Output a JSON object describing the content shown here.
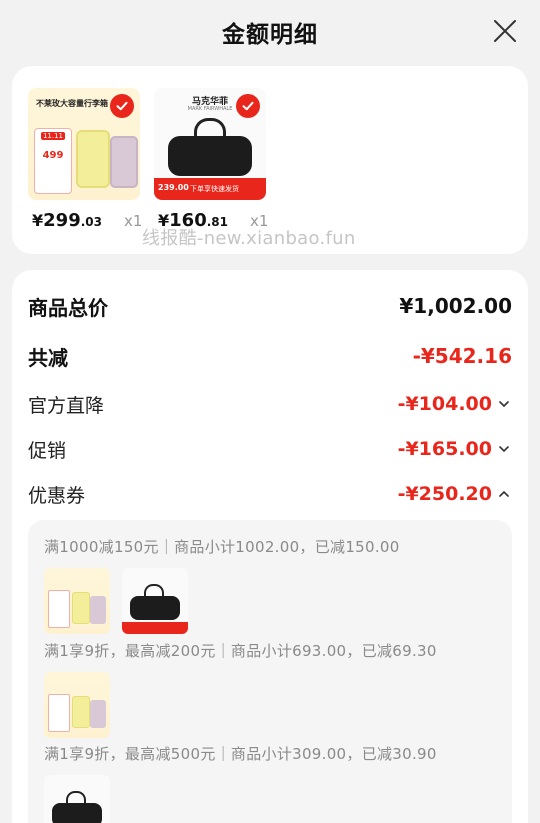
{
  "header": {
    "title": "金额明细",
    "close_icon": "close-icon"
  },
  "products": [
    {
      "name": "luggage",
      "thumb_title": "不莱玫大容量行李箱",
      "thumb_badge": "11.11",
      "thumb_price": "499",
      "price_currency": "¥",
      "price_int": "299",
      "price_dec": ".03",
      "qty": "x1"
    },
    {
      "name": "duffel-bag",
      "thumb_title": "马克华菲",
      "thumb_sub": "MARK FAIRWHALE",
      "thumb_price": "239.00",
      "thumb_promo": "下单享快速发货",
      "price_currency": "¥",
      "price_int": "160",
      "price_dec": ".81",
      "qty": "x1"
    }
  ],
  "watermark": "线报酷-new.xianbao.fun",
  "summary": {
    "total_label": "商品总价",
    "total_value": "¥1,002.00",
    "discount_label": "共减",
    "discount_value": "-¥542.16",
    "official_label": "官方直降",
    "official_value": "-¥104.00",
    "promo_label": "促销",
    "promo_value": "-¥165.00",
    "coupon_label": "优惠券",
    "coupon_value": "-¥250.20"
  },
  "coupons": [
    {
      "text": "满1000减150元｜商品小计1002.00，已减150.00"
    },
    {
      "text": "满1享9折，最高减200元｜商品小计693.00，已减69.30"
    },
    {
      "text": "满1享9折，最高减500元｜商品小计309.00，已减30.90"
    }
  ],
  "colors": {
    "accent": "#e8261b",
    "panel": "#f5f5f5",
    "page_bg": "#f2f2f2"
  }
}
